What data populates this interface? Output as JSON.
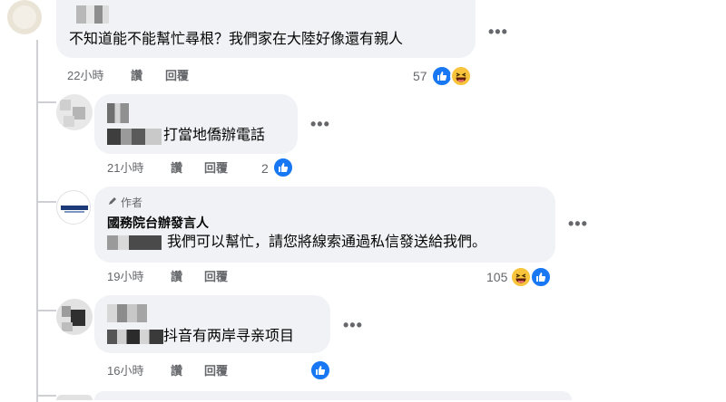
{
  "comments": [
    {
      "text": "不知道能不能幫忙尋根？我們家在大陸好像還有親人",
      "meta": {
        "time": "22小時",
        "like": "讚",
        "reply": "回覆"
      },
      "reaction_count": "57",
      "reactions": [
        "like-icon",
        "haha-icon"
      ]
    },
    {
      "text": "打當地僑辦電話",
      "meta": {
        "time": "21小時",
        "like": "讚",
        "reply": "回覆"
      },
      "reaction_count": "2",
      "reactions": [
        "like-icon"
      ]
    },
    {
      "author_badge": "作者",
      "author_name": "國務院台辦發言人",
      "text": "我們可以幫忙，請您將線索通過私信發送給我們。",
      "meta": {
        "time": "19小時",
        "like": "讚",
        "reply": "回覆"
      },
      "reaction_count": "105",
      "reactions": [
        "haha-icon",
        "like-icon"
      ]
    },
    {
      "text": "抖音有两岸寻亲项目",
      "meta": {
        "time": "16小時",
        "like": "讚",
        "reply": "回覆"
      },
      "reaction_count": "",
      "reactions": [
        "like-icon"
      ]
    }
  ],
  "more_options_label": "•••",
  "colors": {
    "bubble": "#f0f2f5",
    "meta_text": "#65676b",
    "like_blue": "#1877f2",
    "haha_yellow": "#f7c43b",
    "thread_line": "#ced0d4"
  }
}
